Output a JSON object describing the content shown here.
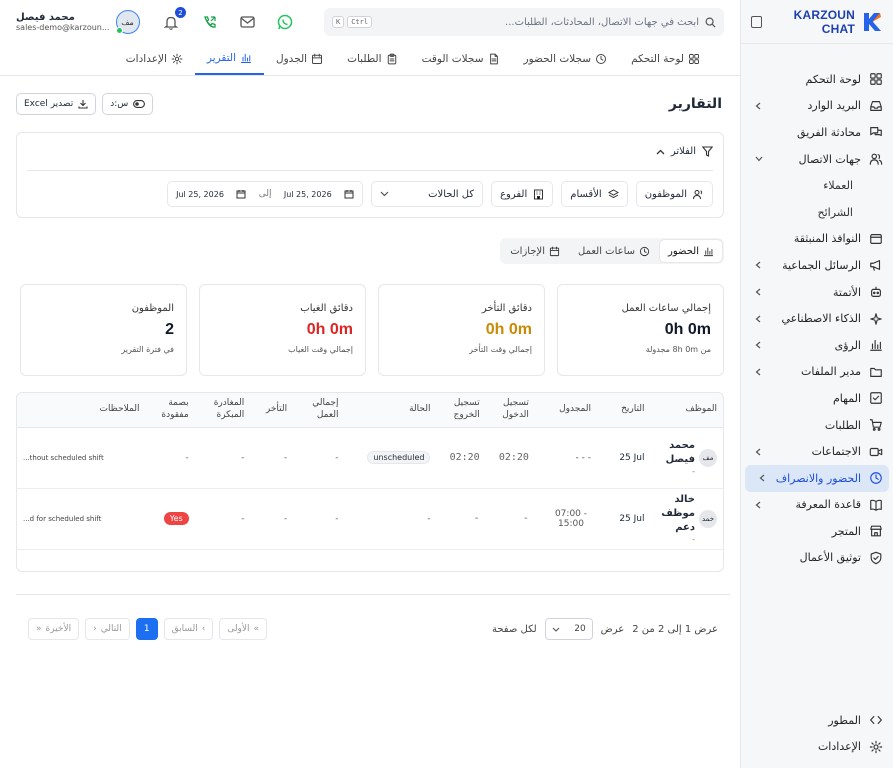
{
  "brand": {
    "name": "KARZOUN CHAT"
  },
  "sidebar": {
    "items": [
      {
        "label": "لوحة التحكم",
        "icon": "dashboard-icon",
        "chevron": false
      },
      {
        "label": "البريد الوارد",
        "icon": "inbox-icon",
        "chevron": true
      },
      {
        "label": "محادثة الفريق",
        "icon": "chat-icon",
        "chevron": false
      },
      {
        "label": "جهات الاتصال",
        "icon": "users-icon",
        "chevron": true,
        "expanded": true
      },
      {
        "label": "العملاء",
        "sub": true
      },
      {
        "label": "الشرائح",
        "sub": true
      },
      {
        "label": "النوافذ المنبثقة",
        "icon": "popup-icon",
        "chevron": false
      },
      {
        "label": "الرسائل الجماعية",
        "icon": "megaphone-icon",
        "chevron": true
      },
      {
        "label": "الأتمتة",
        "icon": "bot-icon",
        "chevron": true
      },
      {
        "label": "الذكاء الاصطناعي",
        "icon": "sparkle-icon",
        "chevron": true
      },
      {
        "label": "الرؤى",
        "icon": "bar-chart-icon",
        "chevron": true
      },
      {
        "label": "مدير الملفات",
        "icon": "folder-icon",
        "chevron": true
      },
      {
        "label": "المهام",
        "icon": "checkbox-icon",
        "chevron": false
      },
      {
        "label": "الطلبات",
        "icon": "cart-icon",
        "chevron": false
      },
      {
        "label": "الاجتماعات",
        "icon": "video-icon",
        "chevron": true
      },
      {
        "label": "الحضور والانصراف",
        "icon": "clock-icon",
        "chevron": true,
        "active": true
      },
      {
        "label": "قاعدة المعرفة",
        "icon": "book-icon",
        "chevron": true
      },
      {
        "label": "المتجر",
        "icon": "store-icon",
        "chevron": false
      },
      {
        "label": "توثيق الأعمال",
        "icon": "shield-check-icon",
        "chevron": false
      }
    ],
    "bottom": [
      {
        "label": "المطور",
        "icon": "code-icon"
      },
      {
        "label": "الإعدادات",
        "icon": "gear-icon"
      }
    ]
  },
  "topbar": {
    "search_placeholder": "ابحث في جهات الاتصال، المحادثات، الطلبات...",
    "kbd": [
      "Ctrl",
      "K"
    ],
    "notif_count": "2",
    "user": {
      "name": "محمد فيصل",
      "email": "sales-demo@karzoun...",
      "initials": "مف"
    }
  },
  "tabs": [
    {
      "label": "لوحة التحكم",
      "icon": "grid-icon"
    },
    {
      "label": "سجلات الحضور",
      "icon": "clock-icon"
    },
    {
      "label": "سجلات الوقت",
      "icon": "file-icon"
    },
    {
      "label": "الطلبات",
      "icon": "clipboard-icon"
    },
    {
      "label": "الجدول",
      "icon": "calendar-icon"
    },
    {
      "label": "التقرير",
      "icon": "bar-chart-icon",
      "active": true
    },
    {
      "label": "الإعدادات",
      "icon": "gear-icon"
    }
  ],
  "page": {
    "title": "التقارير",
    "export_label": "تصدير Excel",
    "toggle_label": "س:د"
  },
  "filters": {
    "title": "الفلاتر",
    "employees": "الموظفون",
    "departments": "الأقسام",
    "branches": "الفروع",
    "status": "كل الحالات",
    "date_from": "Jul 25, 2026",
    "to": "إلى",
    "date_to": "Jul 25, 2026"
  },
  "subtabs": [
    {
      "label": "الحضور",
      "icon": "bar-chart-icon",
      "active": true
    },
    {
      "label": "ساعات العمل",
      "icon": "clock-icon"
    },
    {
      "label": "الإجازات",
      "icon": "calendar-icon"
    }
  ],
  "cards": [
    {
      "title": "إجمالي ساعات العمل",
      "value": "0h 0m",
      "sub": "من 8h 0m مجدولة",
      "color": "#111827"
    },
    {
      "title": "دقائق التأخر",
      "value": "0h 0m",
      "sub": "إجمالي وقت التأخر",
      "color": "#ca8a04"
    },
    {
      "title": "دقائق الغياب",
      "value": "0h 0m",
      "sub": "إجمالي وقت الغياب",
      "color": "#dc2626"
    },
    {
      "title": "الموظفون",
      "value": "2",
      "sub": "في فترة التقرير",
      "color": "#111827"
    }
  ],
  "table": {
    "headers": [
      "الموظف",
      "التاريخ",
      "المجدول",
      "تسجيل الدخول",
      "تسجيل الخروج",
      "الحالة",
      "إجمالي العمل",
      "التأخر",
      "المغادرة المبكرة",
      "بصمة مفقودة",
      "الملاحظات"
    ],
    "rows": [
      {
        "initials": "مف",
        "name": "محمد فيصل",
        "subname": "-",
        "date": "25 Jul",
        "scheduled": "- - -",
        "checkin": "02:20",
        "checkout": "02:20",
        "status": "unscheduled",
        "total": "-",
        "late": "-",
        "early": "-",
        "missing": "-",
        "notes": "...thout scheduled shift"
      },
      {
        "initials": "خمد",
        "name": "خالد موظف دعم",
        "subname": "-",
        "date": "25 Jul",
        "scheduled": "07:00 - 15:00",
        "checkin": "-",
        "checkout": "-",
        "status": "-",
        "total": "-",
        "late": "-",
        "early": "-",
        "missing": "Yes",
        "notes": "...d for scheduled shift"
      }
    ]
  },
  "pager": {
    "info": "عرض 1 إلى 2 من 2",
    "show": "عرض",
    "page_size": "20",
    "per_page": "لكل صفحة",
    "first": "الأولى",
    "prev": "السابق",
    "current": "1",
    "next": "التالي",
    "last": "الأخيرة"
  },
  "colors": {
    "accent": "#2563eb",
    "late": "#ca8a04",
    "absent": "#dc2626",
    "whatsapp": "#22c55e"
  }
}
